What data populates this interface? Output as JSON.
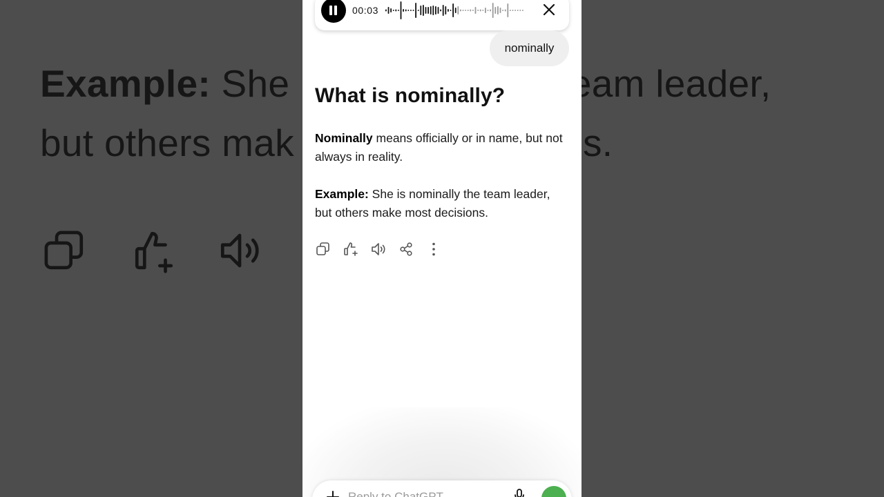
{
  "background": {
    "example_label": "Example:",
    "line1_visible": "She is",
    "line1_tail": "team leader,",
    "line2_head": "but others mak",
    "line2_tail": "s."
  },
  "voice_player": {
    "elapsed": "00:03"
  },
  "user_message": "nominally",
  "answer": {
    "title": "What is nominally?",
    "definition_term": "Nominally",
    "definition_text": " means officially or in name, but not always in reality.",
    "example_label": "Example:",
    "example_text": " She is nominally the team leader, but others make most decisions."
  },
  "actions": [
    "copy-icon",
    "thumbs-up-icon",
    "read-aloud-icon",
    "share-icon",
    "more-icon"
  ],
  "composer": {
    "placeholder": "Reply to ChatGPT"
  },
  "colors": {
    "backdrop": "#4d4d4d",
    "voice_button": "#4caf50"
  }
}
